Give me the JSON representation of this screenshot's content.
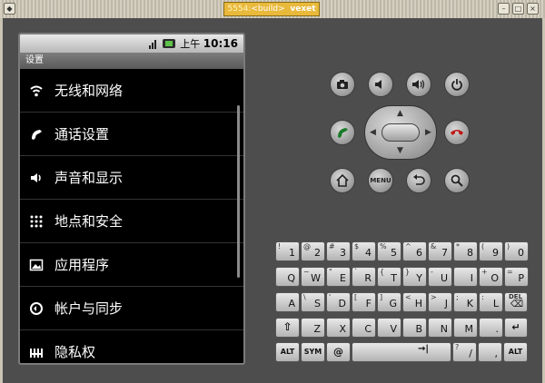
{
  "window": {
    "port": "5554:",
    "build": "<build>",
    "name": "vexet"
  },
  "status": {
    "ampm": "上午",
    "time": "10:16"
  },
  "app": {
    "title": "设置"
  },
  "settings": [
    {
      "label": "无线和网络",
      "icon": "wifi-icon"
    },
    {
      "label": "通话设置",
      "icon": "phone-icon"
    },
    {
      "label": "声音和显示",
      "icon": "speaker-icon"
    },
    {
      "label": "地点和安全",
      "icon": "grid-icon"
    },
    {
      "label": "应用程序",
      "icon": "picture-icon"
    },
    {
      "label": "帐户与同步",
      "icon": "sync-icon"
    },
    {
      "label": "隐私权",
      "icon": "bars-icon"
    }
  ],
  "buttons": {
    "menu": "MENU"
  },
  "keyboard": {
    "row1": [
      {
        "m": "1",
        "s": "!"
      },
      {
        "m": "2",
        "s": "@"
      },
      {
        "m": "3",
        "s": "#"
      },
      {
        "m": "4",
        "s": "$"
      },
      {
        "m": "5",
        "s": "%"
      },
      {
        "m": "6",
        "s": "^"
      },
      {
        "m": "7",
        "s": "&"
      },
      {
        "m": "8",
        "s": "*"
      },
      {
        "m": "9",
        "s": "("
      },
      {
        "m": "0",
        "s": ")"
      }
    ],
    "row2": [
      {
        "m": "Q",
        "s": ""
      },
      {
        "m": "W",
        "s": "~"
      },
      {
        "m": "E",
        "s": "\""
      },
      {
        "m": "R",
        "s": "`"
      },
      {
        "m": "T",
        "s": "{"
      },
      {
        "m": "Y",
        "s": "}"
      },
      {
        "m": "U",
        "s": "-"
      },
      {
        "m": "I",
        "s": ""
      },
      {
        "m": "O",
        "s": "+"
      },
      {
        "m": "P",
        "s": "="
      }
    ],
    "row3": [
      {
        "m": "A",
        "s": ""
      },
      {
        "m": "S",
        "s": "\\"
      },
      {
        "m": "D",
        "s": "'"
      },
      {
        "m": "F",
        "s": "["
      },
      {
        "m": "G",
        "s": "]"
      },
      {
        "m": "H",
        "s": "<"
      },
      {
        "m": "J",
        "s": ">"
      },
      {
        "m": "K",
        "s": ";"
      },
      {
        "m": "L",
        "s": ":"
      }
    ],
    "del": "DEL",
    "row4": [
      {
        "m": "Z",
        "s": ""
      },
      {
        "m": "X",
        "s": ""
      },
      {
        "m": "C",
        "s": ""
      },
      {
        "m": "V",
        "s": ""
      },
      {
        "m": "B",
        "s": ""
      },
      {
        "m": "N",
        "s": ""
      },
      {
        "m": "M",
        "s": ""
      },
      {
        "m": ".",
        "s": ""
      }
    ],
    "alt": "ALT",
    "sym": "SYM",
    "at": "@",
    "slash": "/",
    "comma": ",",
    "qmark": "?"
  }
}
